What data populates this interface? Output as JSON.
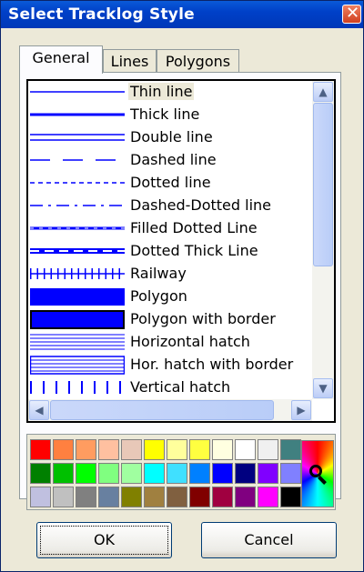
{
  "window": {
    "title": "Select Tracklog Style"
  },
  "tabs": [
    {
      "label": "General",
      "active": true
    },
    {
      "label": "Lines",
      "active": false
    },
    {
      "label": "Polygons",
      "active": false
    }
  ],
  "styles": {
    "selected_index": 0,
    "items": [
      {
        "label": "Thin line",
        "icon": "thin-line-icon"
      },
      {
        "label": "Thick line",
        "icon": "thick-line-icon"
      },
      {
        "label": "Double line",
        "icon": "double-line-icon"
      },
      {
        "label": "Dashed line",
        "icon": "dashed-line-icon"
      },
      {
        "label": "Dotted line",
        "icon": "dotted-line-icon"
      },
      {
        "label": "Dashed-Dotted line",
        "icon": "dashed-dotted-line-icon"
      },
      {
        "label": "Filled Dotted Line",
        "icon": "filled-dotted-line-icon"
      },
      {
        "label": "Dotted Thick Line",
        "icon": "dotted-thick-line-icon"
      },
      {
        "label": "Railway",
        "icon": "railway-icon"
      },
      {
        "label": "Polygon",
        "icon": "polygon-icon"
      },
      {
        "label": "Polygon with border",
        "icon": "polygon-with-border-icon"
      },
      {
        "label": "Horizontal hatch",
        "icon": "horizontal-hatch-icon"
      },
      {
        "label": "Hor. hatch with border",
        "icon": "hor-hatch-with-border-icon"
      },
      {
        "label": "Vertical hatch",
        "icon": "vertical-hatch-icon"
      }
    ]
  },
  "palette": {
    "rows": [
      [
        "#ff0000",
        "#ff8040",
        "#ff9c60",
        "#ffc0a0",
        "#e8c8b8",
        "#ffff00",
        "#ffff9c",
        "#ffff40",
        "#ffffe0",
        "#ffffff",
        "#f0f0f0",
        "#408080"
      ],
      [
        "#008000",
        "#00c000",
        "#00ff00",
        "#80ff80",
        "#a0ffa0",
        "#00ffff",
        "#40e0ff",
        "#0080ff",
        "#0000ff",
        "#000080",
        "#8000ff",
        "#8080ff"
      ],
      [
        "#c0c0e0",
        "#c0c0c0",
        "#808080",
        "#6880a0",
        "#808000",
        "#a08040",
        "#806040",
        "#800000",
        "#a00040",
        "#800080",
        "#ff00ff",
        "#000000"
      ]
    ],
    "picker_icon": "color-picker-icon"
  },
  "buttons": {
    "ok": "OK",
    "cancel": "Cancel"
  },
  "colors": {
    "title_bar": "#0040c8",
    "line_blue": "#0000ff",
    "dialog_bg": "#ece9d8"
  }
}
